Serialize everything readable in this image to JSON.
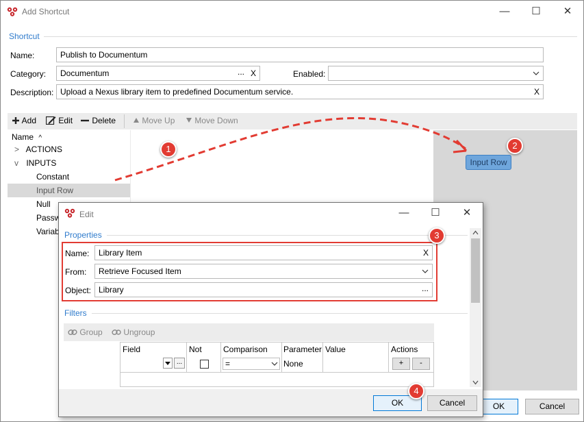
{
  "main_window": {
    "title": "Add Shortcut",
    "controls": {
      "minimize": "—",
      "maximize": "☐",
      "close": "✕"
    },
    "group_label": "Shortcut",
    "name_label": "Name:",
    "name_value": "Publish to  Documentum",
    "category_label": "Category:",
    "category_value": "Documentum",
    "category_dots": "...",
    "category_clear": "X",
    "enabled_label": "Enabled:",
    "enabled_value": "",
    "description_label": "Description:",
    "description_value": "Upload a Nexus library item to predefined Documentum service.",
    "description_clear": "X",
    "ok_label": "OK",
    "cancel_label": "Cancel"
  },
  "toolbar": {
    "add_label": "Add",
    "edit_label": "Edit",
    "delete_label": "Delete",
    "move_up_label": "Move Up",
    "move_down_label": "Move Down"
  },
  "tree": {
    "header": "Name",
    "sort_glyph": "^",
    "items": [
      {
        "label": "ACTIONS",
        "expander": ">"
      },
      {
        "label": "INPUTS",
        "expander": "v"
      },
      {
        "label": "Constant"
      },
      {
        "label": "Input Row"
      },
      {
        "label": "Null"
      },
      {
        "label": "Passw"
      },
      {
        "label": "Variab"
      }
    ]
  },
  "drag_chip_label": "Input Row",
  "badges": [
    "1",
    "2",
    "3",
    "4"
  ],
  "edit_dialog": {
    "title": "Edit",
    "controls": {
      "minimize": "—",
      "maximize": "☐",
      "close": "✕"
    },
    "properties_label": "Properties",
    "name_label": "Name:",
    "name_value": "Library Item",
    "name_clear": "X",
    "from_label": "From:",
    "from_value": "Retrieve Focused Item",
    "object_label": "Object:",
    "object_value": "Library",
    "object_dots": "...",
    "filters_label": "Filters",
    "group_label": "Group",
    "ungroup_label": "Ungroup",
    "columns": [
      "Field",
      "Not",
      "Comparison",
      "Parameter",
      "Value",
      "Actions"
    ],
    "row": {
      "field_dots": "...",
      "comparison_value": "=",
      "parameter_value": "None",
      "add_btn": "+",
      "remove_btn": "-"
    },
    "ok_label": "OK",
    "cancel_label": "Cancel"
  },
  "colors": {
    "accent": "#2f7bcc",
    "badge": "#e23b32",
    "selection": "#d9d9d9",
    "drag_chip": "#6fa6dc"
  }
}
